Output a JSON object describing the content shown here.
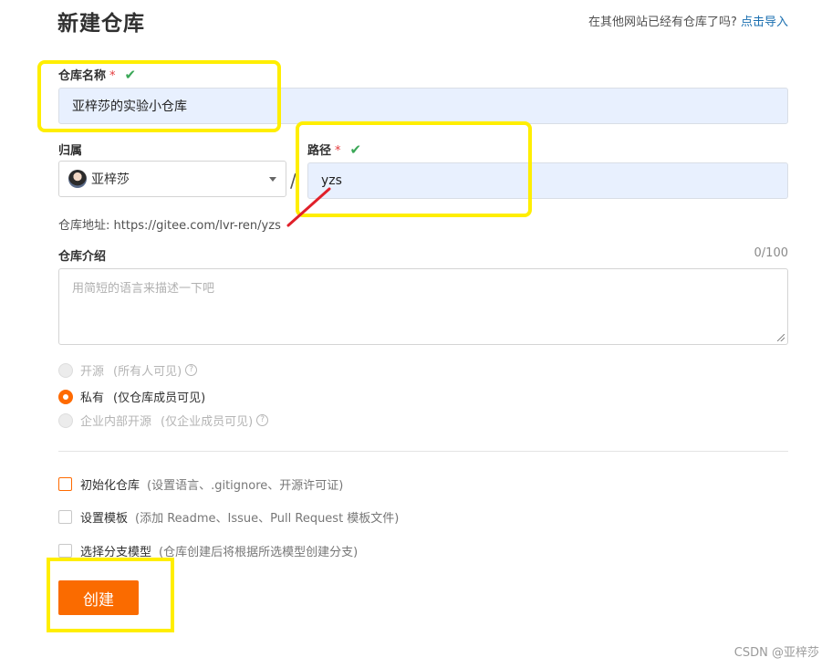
{
  "page": {
    "title": "新建仓库",
    "import_prompt": "在其他网站已经有仓库了吗?",
    "import_link": "点击导入"
  },
  "form": {
    "repo_name": {
      "label": "仓库名称",
      "required_mark": "*",
      "valid_mark": "✔",
      "value": "亚梓莎的实验小仓库"
    },
    "owner": {
      "label": "归属",
      "value": "亚梓莎"
    },
    "separator": "/",
    "path": {
      "label": "路径",
      "required_mark": "*",
      "valid_mark": "✔",
      "value": "yzs"
    },
    "address": {
      "prefix": "仓库地址:",
      "url": "https://gitee.com/lvr-ren/yzs"
    },
    "intro": {
      "label": "仓库介绍",
      "counter": "0/100",
      "placeholder": "用简短的语言来描述一下吧"
    },
    "visibility": [
      {
        "label": "开源",
        "hint": "(所有人可见)",
        "selected": false,
        "disabled": true,
        "help_icon": "question-icon"
      },
      {
        "label": "私有",
        "hint": "(仅仓库成员可见)",
        "selected": true,
        "disabled": false
      },
      {
        "label": "企业内部开源",
        "hint": "(仅企业成员可见)",
        "selected": false,
        "disabled": true,
        "help_icon": "question-icon"
      }
    ],
    "options": [
      {
        "label": "初始化仓库",
        "hint": "(设置语言、.gitignore、开源许可证)",
        "checked": false
      },
      {
        "label": "设置模板",
        "hint": "(添加 Readme、Issue、Pull Request 模板文件)",
        "checked": false
      },
      {
        "label": "选择分支模型",
        "hint": "(仓库创建后将根据所选模型创建分支)",
        "checked": false
      }
    ],
    "submit_label": "创建"
  },
  "watermark": "CSDN @亚梓莎",
  "colors": {
    "accent": "#fa6b00",
    "valid": "#3aa757",
    "required": "#e4393c",
    "link": "#1a6fb0",
    "highlight": "#ffee00",
    "annotation": "#e0202a"
  }
}
